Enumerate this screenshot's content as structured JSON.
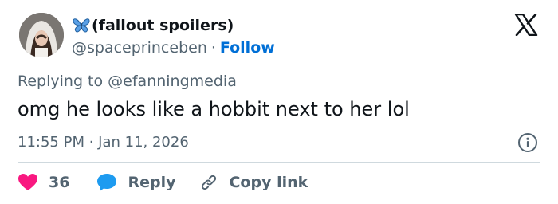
{
  "user": {
    "display_name": "(fallout spoilers)",
    "handle": "@spaceprinceben",
    "separator": "·",
    "follow_label": "Follow"
  },
  "reply": {
    "prefix": "Replying to",
    "mention": "@efanningmedia"
  },
  "tweet": {
    "text": "omg he looks like a hobbit next to her lol",
    "timestamp": "11:55 PM · Jan 11, 2026"
  },
  "actions": {
    "like_count": "36",
    "reply_label": "Reply",
    "copy_label": "Copy link"
  },
  "colors": {
    "accent": "#006fd6",
    "like": "#f91880",
    "reply": "#1d9bf0",
    "secondary_text": "#536471",
    "primary_text": "#0f1419",
    "divider": "#cfd9de"
  },
  "icons": {
    "name_emoji": "butterfly-icon",
    "platform": "x-logo-icon",
    "info": "info-icon",
    "like": "heart-icon",
    "reply": "speech-bubble-icon",
    "copy": "link-icon"
  }
}
